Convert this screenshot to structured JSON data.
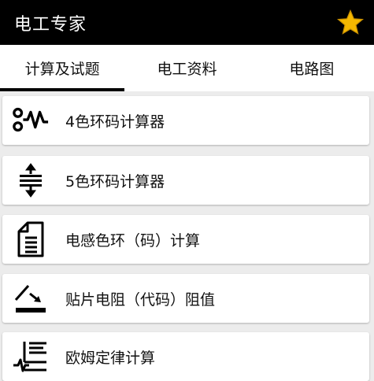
{
  "appbar": {
    "title": "电工专家",
    "star_icon": "star-icon",
    "star_color": "#f5b800"
  },
  "tabs": [
    {
      "label": "计算及试题",
      "active": true
    },
    {
      "label": "电工资料",
      "active": false
    },
    {
      "label": "电路图",
      "active": false
    }
  ],
  "items": [
    {
      "label": "4色环码计算器",
      "icon": "resistor-wave-icon"
    },
    {
      "label": "5色环码计算器",
      "icon": "resistor-bands-icon"
    },
    {
      "label": "电感色环（码）计算",
      "icon": "document-icon"
    },
    {
      "label": "贴片电阻（代码）阻值",
      "icon": "smd-resistor-icon"
    },
    {
      "label": "欧姆定律计算",
      "icon": "ohms-law-icon"
    }
  ]
}
